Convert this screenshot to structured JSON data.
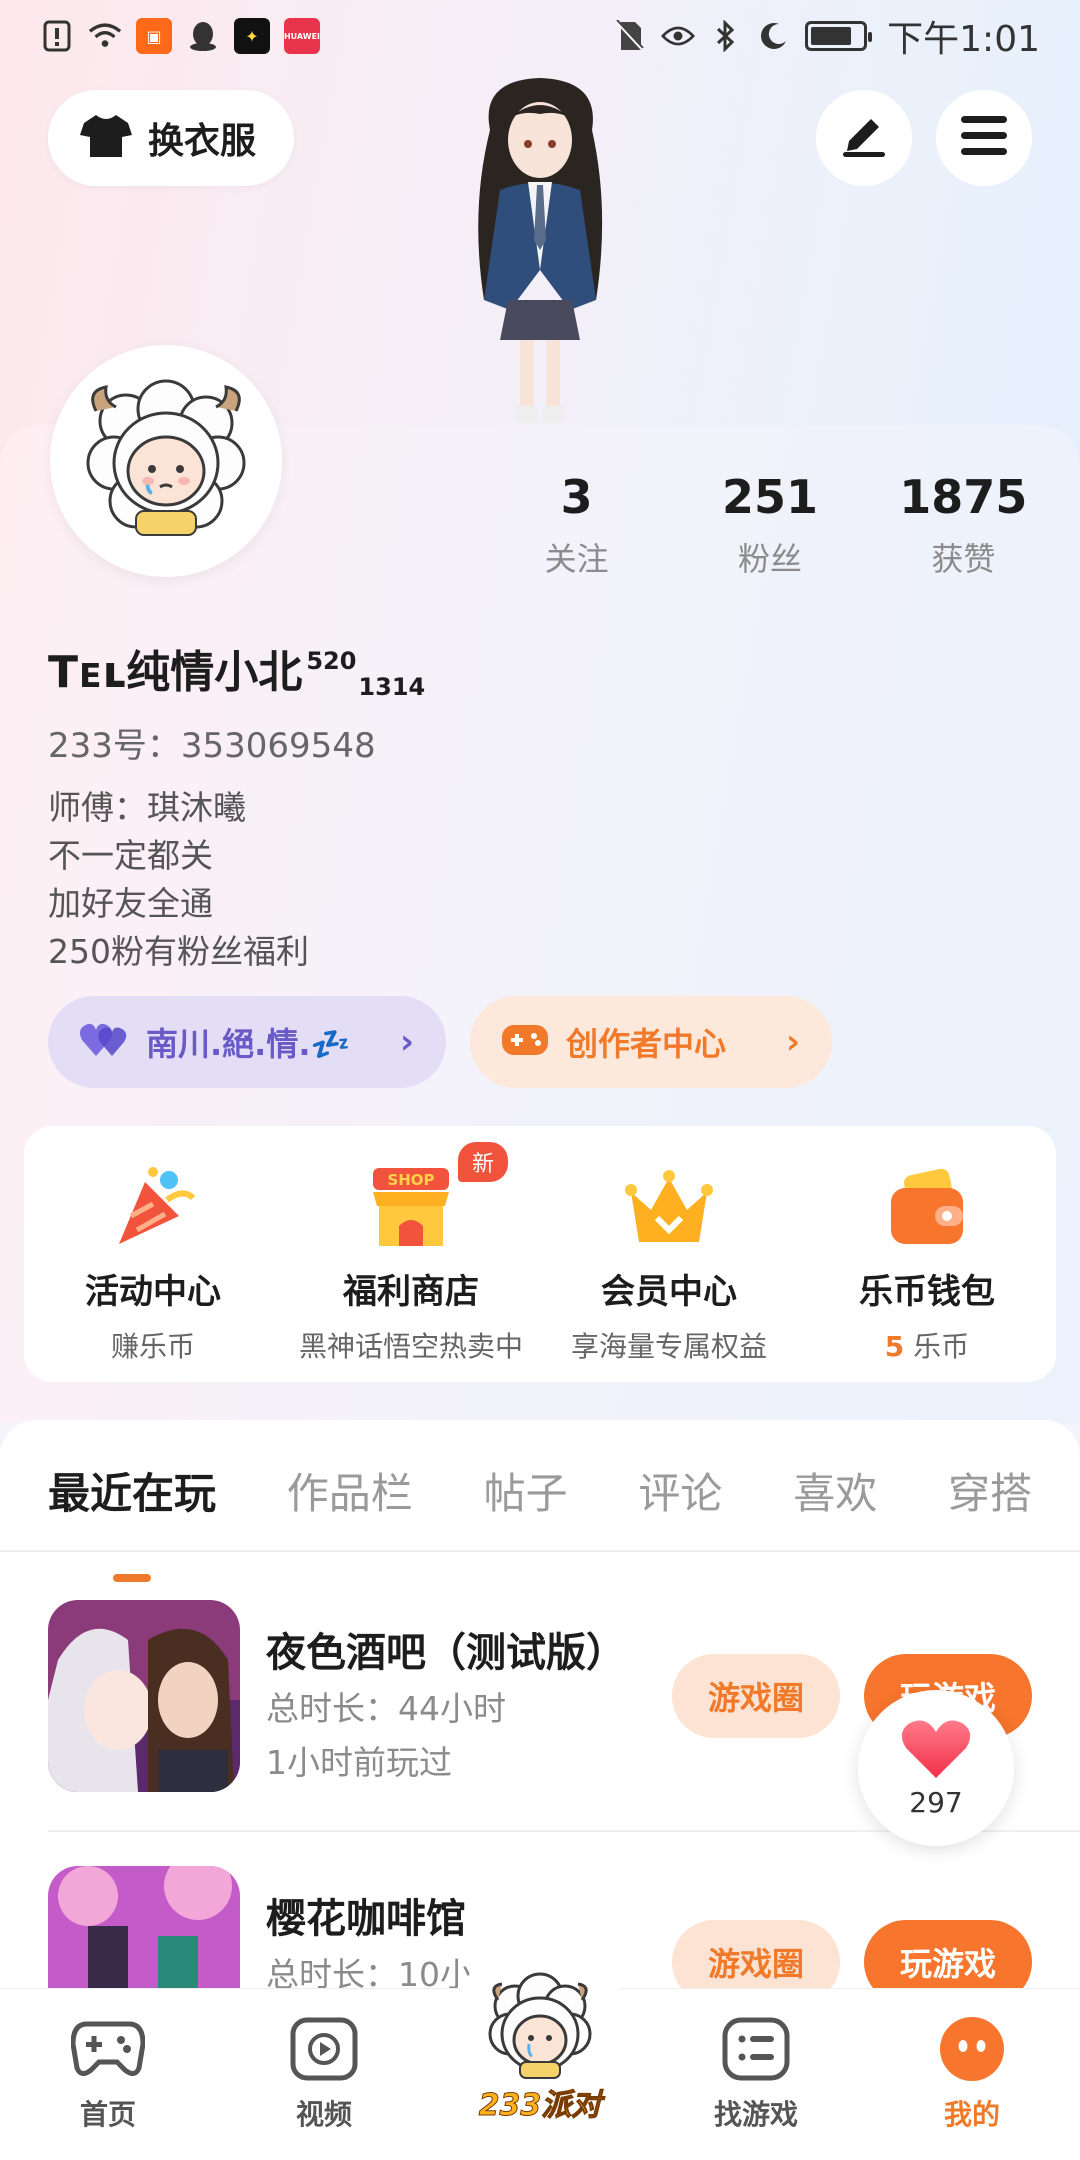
{
  "status_bar": {
    "time": "下午1:01",
    "battery_level": 0.8,
    "icons": [
      "alert-icon",
      "wifi-icon",
      "kuaishou-app-icon",
      "qq-app-icon",
      "sparkle-app-icon",
      "huawei-app-icon",
      "no-sim-icon",
      "eye-icon",
      "bluetooth-icon",
      "moon-icon",
      "battery-icon"
    ],
    "huawei_label": "HUAWEI"
  },
  "header": {
    "outfit_label": "换衣服",
    "edit_icon": "pen-icon",
    "menu_icon": "menu-icon"
  },
  "profile": {
    "stats": [
      {
        "value": "3",
        "label": "关注"
      },
      {
        "value": "251",
        "label": "粉丝"
      },
      {
        "value": "1875",
        "label": "获赞"
      }
    ],
    "nickname_main": "Tᴇʟ纯情小北",
    "nickname_sup": "520",
    "nickname_sub": "1314",
    "uid": "233号：353069548",
    "bio": [
      "师傅：琪沐曦",
      "不一定都关",
      "加好友全通",
      "250粉有粉丝福利"
    ],
    "partner_label": "南川.絕.情.💤",
    "creator_label": "创作者中心"
  },
  "services": [
    {
      "title": "活动中心",
      "sub": "赚乐币"
    },
    {
      "title": "福利商店",
      "sub": "黑神话悟空热卖中",
      "badge": "新",
      "icon_text": "SHOP"
    },
    {
      "title": "会员中心",
      "sub": "享海量专属权益"
    },
    {
      "title": "乐币钱包",
      "sub_value": "5",
      "sub_unit": " 乐币"
    }
  ],
  "tabs": [
    "最近在玩",
    "作品栏",
    "帖子",
    "评论",
    "喜欢",
    "穿搭"
  ],
  "games": [
    {
      "name": "夜色酒吧（测试版）",
      "duration": "总时长：44小时",
      "last_played": "1小时前玩过",
      "circle_label": "游戏圈",
      "play_label": "玩游戏"
    },
    {
      "name": "樱花咖啡馆",
      "duration": "总时长：10小",
      "circle_label": "游戏圈",
      "play_label": "玩游戏"
    }
  ],
  "like_float": {
    "count": "297"
  },
  "bottom_nav": [
    {
      "label": "首页",
      "icon": "gamepad-icon"
    },
    {
      "label": "视频",
      "icon": "video-play-icon"
    },
    {
      "label": "233派对",
      "icon": "party-mascot-icon"
    },
    {
      "label": "找游戏",
      "icon": "list-icon"
    },
    {
      "label": "我的",
      "icon": "profile-face-icon"
    }
  ],
  "colors": {
    "accent": "#f07a2a",
    "partner_purple": "#6a5ac8",
    "badge_red": "#f2533d"
  }
}
